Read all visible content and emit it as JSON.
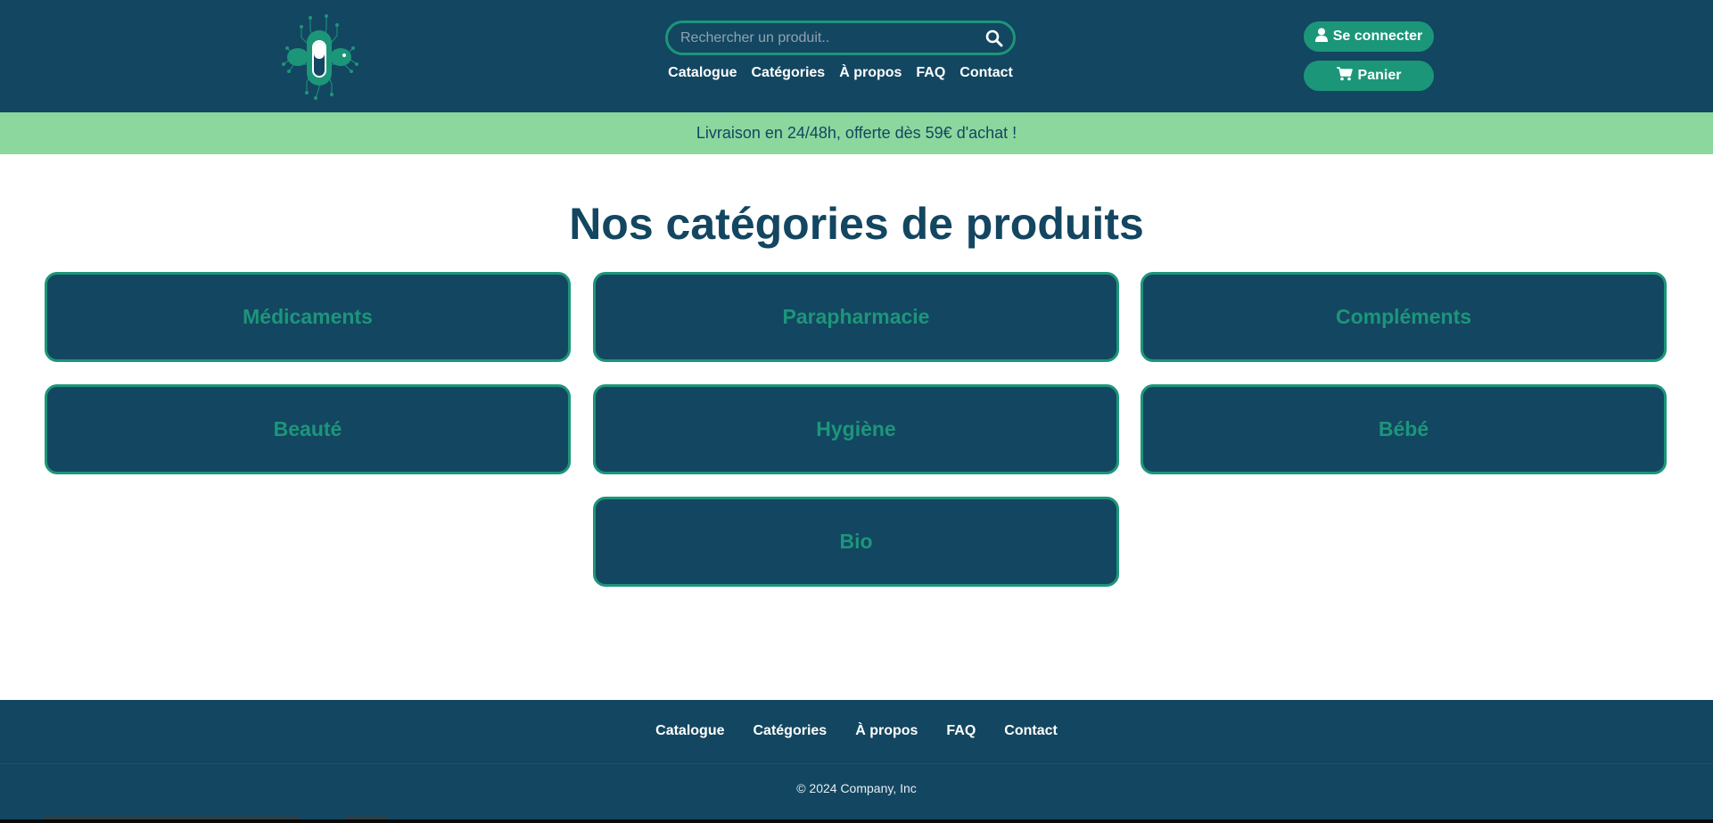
{
  "header": {
    "logo_icon": "pill-circuit-logo",
    "search": {
      "placeholder": "Rechercher un produit..",
      "icon": "search-icon"
    },
    "nav": [
      "Catalogue",
      "Catégories",
      "À propos",
      "FAQ",
      "Contact"
    ],
    "login_label": "Se connecter",
    "login_icon": "user-icon",
    "cart_label": "Panier",
    "cart_icon": "cart-icon"
  },
  "promo": {
    "text": "Livraison en 24/48h, offerte dès 59€ d'achat !"
  },
  "main": {
    "title": "Nos catégories de produits",
    "categories": [
      "Médicaments",
      "Parapharmacie",
      "Compléments",
      "Beauté",
      "Hygiène",
      "Bébé",
      "Bio"
    ]
  },
  "footer": {
    "nav": [
      "Catalogue",
      "Catégories",
      "À propos",
      "FAQ",
      "Contact"
    ],
    "copyright": "© 2024 Company, Inc"
  },
  "colors": {
    "navy": "#134661",
    "green": "#1c9679",
    "promo_green": "#8cd79e",
    "white": "#ffffff"
  }
}
